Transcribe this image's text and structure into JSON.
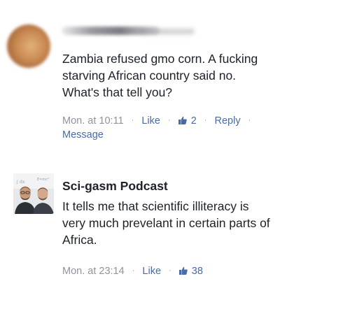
{
  "comments": [
    {
      "author": "",
      "text": "Zambia refused gmo corn. A fucking\nstarving African country said no.\nWhat's that tell you?",
      "timestamp": "Mon. at 10:11",
      "like_label": "Like",
      "like_count": "2",
      "reply_label": "Reply",
      "message_label": "Message",
      "separator": "·",
      "icons": {
        "likes": "thumbs-up-icon"
      }
    },
    {
      "author": "Sci-gasm Podcast",
      "text": "It tells me that scientific illiteracy is\nvery much prevelant in certain parts of\nAfrica.",
      "timestamp": "Mon. at 23:14",
      "like_label": "Like",
      "like_count": "38",
      "separator": "·",
      "icons": {
        "likes": "thumbs-up-icon"
      }
    }
  ],
  "colors": {
    "body_text": "#1d2129",
    "meta_text": "#90949c",
    "link": "#4a6aa8"
  }
}
